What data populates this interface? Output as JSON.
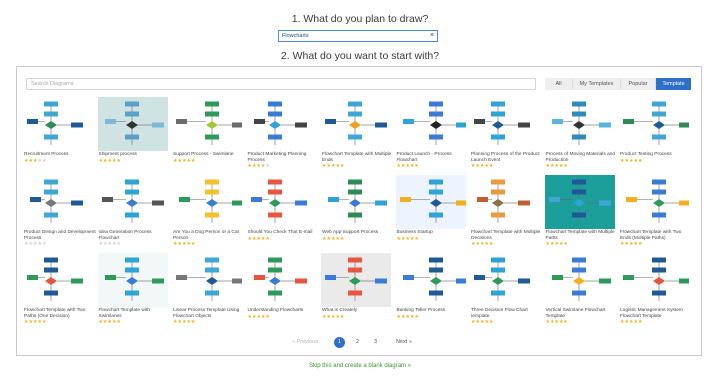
{
  "step1_title": "1. What do you plan to draw?",
  "draw_input": {
    "value": "Flowcharts",
    "clear_icon": "×"
  },
  "step2_title": "2. What do you want to start with?",
  "search": {
    "placeholder": "Search Diagrams"
  },
  "tabs": [
    {
      "label": "All",
      "active": false
    },
    {
      "label": "My Templates",
      "active": false
    },
    {
      "label": "Popular",
      "active": false
    },
    {
      "label": "Template",
      "active": true
    }
  ],
  "colors": {
    "accent": "#2f6fc8",
    "star": "#f2b01e",
    "link": "#3a9a2a"
  },
  "templates": [
    {
      "name": "Recruitment Process",
      "rating": 3
    },
    {
      "name": "Shipment process",
      "rating": 5
    },
    {
      "name": "Support Process - Swimlane",
      "rating": 5
    },
    {
      "name": "Product Marketing Planning Process",
      "rating": 4
    },
    {
      "name": "Flowchart Template with Multiple Ends",
      "rating": 5
    },
    {
      "name": "Product Launch - Process Flowchart",
      "rating": 5
    },
    {
      "name": "Planning Process of the Product Launch Event",
      "rating": 5
    },
    {
      "name": "Process of Moving Materials and Production",
      "rating": 5
    },
    {
      "name": "Product Testing Process",
      "rating": 5
    },
    {
      "name": "Product Design and Development Process",
      "rating": 0
    },
    {
      "name": "Idea Generation Process Flowchart",
      "rating": 0
    },
    {
      "name": "Are You a Dog Person or a Cat Person",
      "rating": 5
    },
    {
      "name": "Should You Check That E-mail",
      "rating": 5
    },
    {
      "name": "Web App Support Process",
      "rating": 5
    },
    {
      "name": "Business Startup",
      "rating": 5
    },
    {
      "name": "Flowchart Template with Multiple Decisions",
      "rating": 5
    },
    {
      "name": "Flowchart Template with Multiple Paths",
      "rating": 5
    },
    {
      "name": "Flowchart Template with Two Ends (Multiple Paths)",
      "rating": 5
    },
    {
      "name": "Flowchart Template with Two Paths (One Decision)",
      "rating": 5
    },
    {
      "name": "Flowchart Template with Swimlanes",
      "rating": 5
    },
    {
      "name": "Linear Process Template Using Flowchart Objects",
      "rating": 5
    },
    {
      "name": "Understanding Flowcharts",
      "rating": 5
    },
    {
      "name": "What is Creately",
      "rating": 5
    },
    {
      "name": "Banking Teller Process",
      "rating": 5
    },
    {
      "name": "Three Decision Flow Chart template",
      "rating": 5
    },
    {
      "name": "Vertical Swimlane Flowchart Template",
      "rating": 5
    },
    {
      "name": "Logistic Management System Flowchart Template",
      "rating": 5
    }
  ],
  "pagination": {
    "prev": "« Previous",
    "pages": [
      "1",
      "2",
      "3"
    ],
    "current": "1",
    "next": "Next »"
  },
  "skip_link": "Skip this and create a blank diagram »"
}
